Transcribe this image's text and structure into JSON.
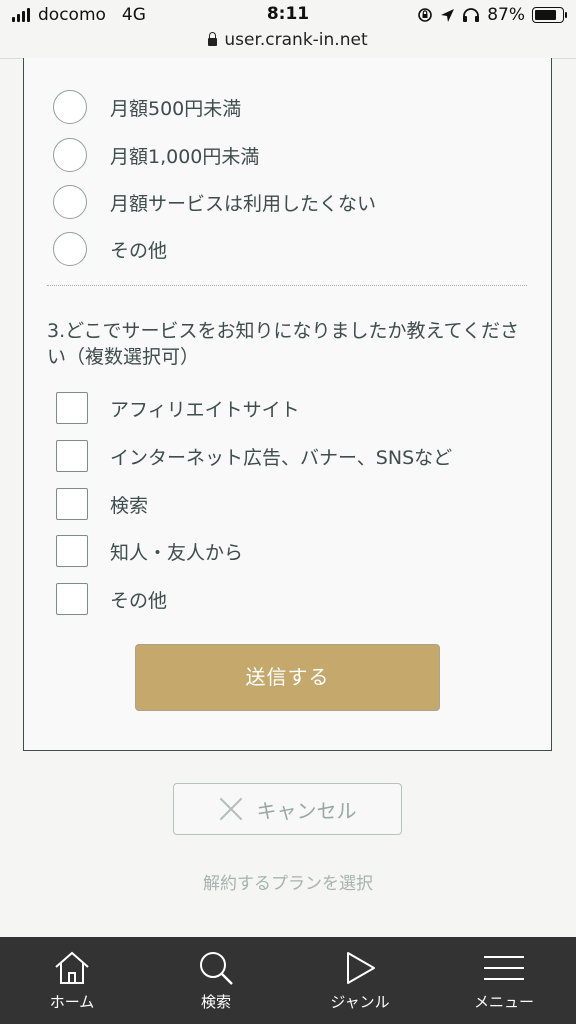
{
  "status_bar": {
    "carrier": "docomo",
    "network": "4G",
    "time": "8:11",
    "battery": "87%",
    "battery_level": 0.87
  },
  "browser": {
    "url": "user.crank-in.net"
  },
  "question2": {
    "options": [
      "月額500円未満",
      "月額1,000円未満",
      "月額サービスは利用したくない",
      "その他"
    ]
  },
  "question3": {
    "title": "3.どこでサービスをお知りになりましたか教えてください（複数選択可）",
    "options": [
      "アフィリエイトサイト",
      "インターネット広告、バナー、SNSなど",
      "検索",
      "知人・友人から",
      "その他"
    ]
  },
  "buttons": {
    "submit": "送信する",
    "cancel": "キャンセル",
    "select_plan": "解約するプランを選択"
  },
  "nav": {
    "items": [
      "ホーム",
      "検索",
      "ジャンル",
      "メニュー"
    ]
  },
  "colors": {
    "submit_bg": "#c4a86c",
    "nav_bg": "#333333",
    "text": "#3f4d4d"
  }
}
